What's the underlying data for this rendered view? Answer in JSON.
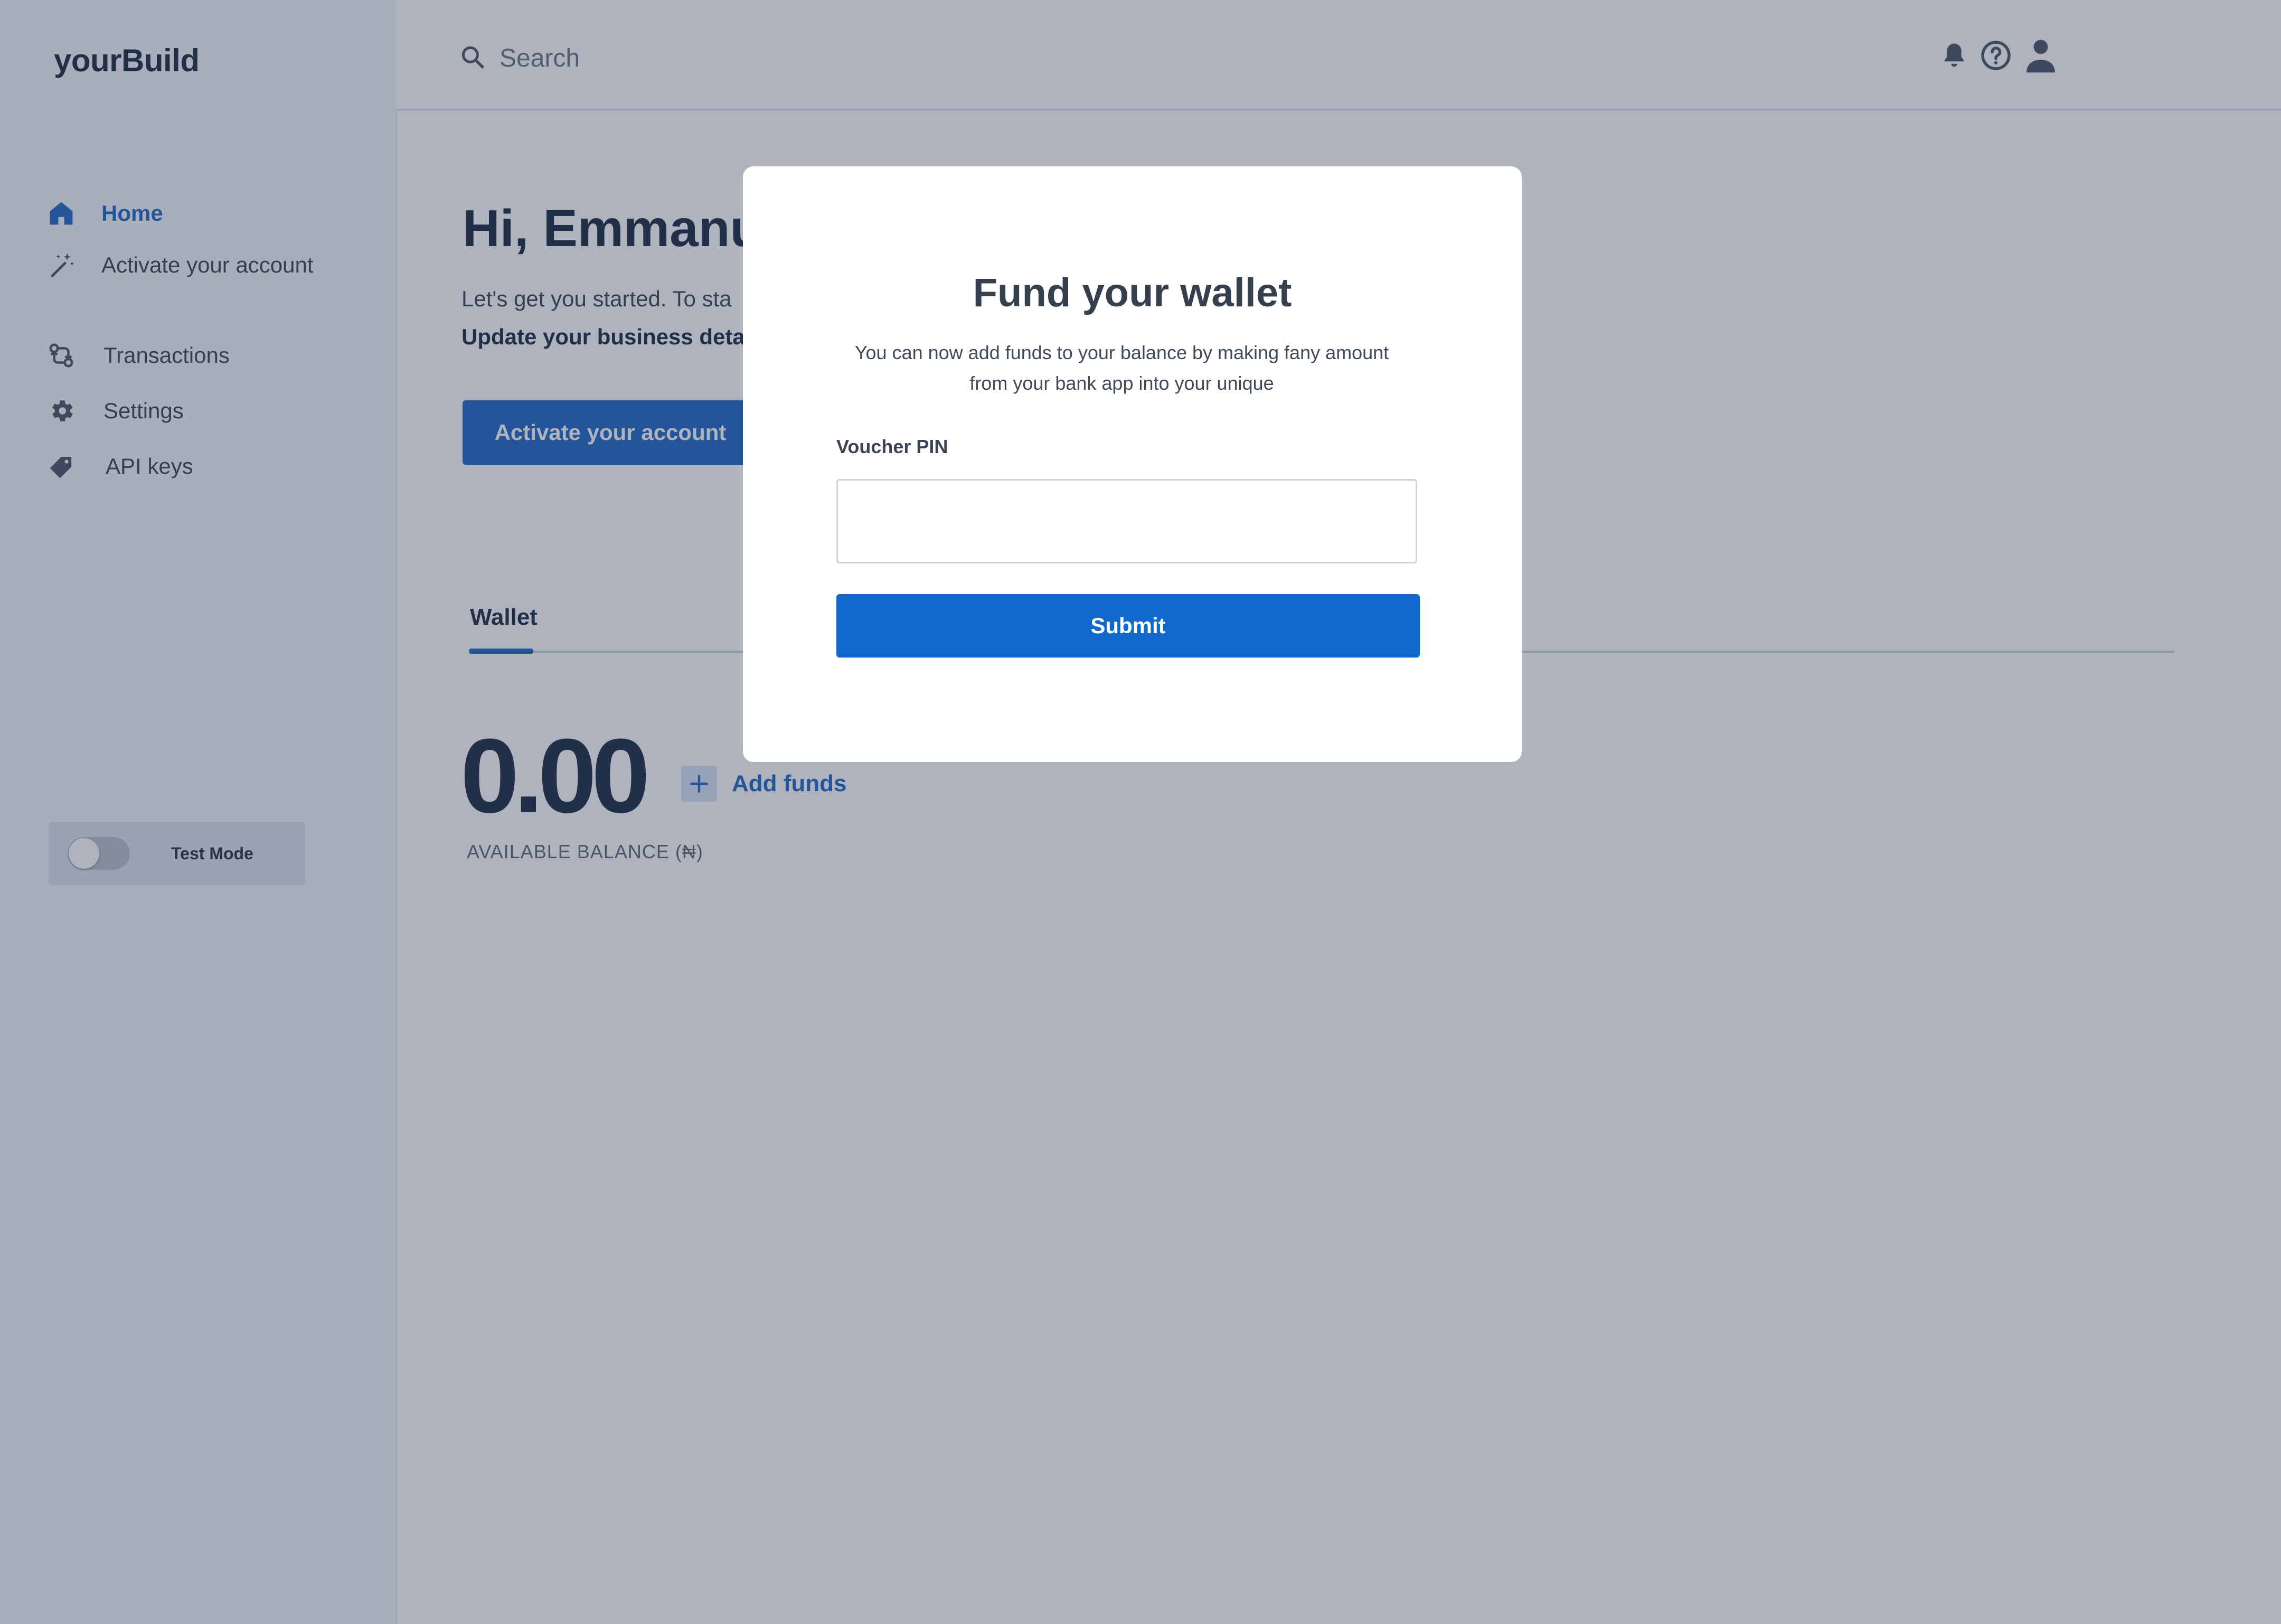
{
  "app": {
    "brand": "yourBuild"
  },
  "sidebar": {
    "items": [
      {
        "label": "Home",
        "icon": "home-icon",
        "active": true
      },
      {
        "label": "Activate your account",
        "icon": "magic-wand-icon"
      },
      {
        "label": "Transactions",
        "icon": "transactions-icon"
      },
      {
        "label": "Settings",
        "icon": "gear-icon"
      },
      {
        "label": "API keys",
        "icon": "tag-icon"
      }
    ],
    "test_mode": {
      "label": "Test Mode",
      "enabled": false
    }
  },
  "header": {
    "search_placeholder": "Search",
    "icons": [
      "bell-icon",
      "help-icon",
      "user-icon"
    ]
  },
  "main": {
    "greeting": "Hi, Emmanu",
    "intro": "Let's get you started. To sta",
    "intro_strong": "Update your business deta",
    "activate_button": "Activate your account",
    "tab": "Wallet",
    "balance": "0.00",
    "add_funds": "Add funds",
    "balance_caption": "AVAILABLE BALANCE (₦)"
  },
  "modal": {
    "title": "Fund your wallet",
    "description_line1": "You can now add funds to your balance by making fany amount",
    "description_line2": "from your bank app into your unique",
    "voucher_label": "Voucher PIN",
    "voucher_value": "",
    "submit_label": "Submit"
  },
  "colors": {
    "accent": "#1f66c5",
    "submit": "#0f6acb",
    "overlay": "rgba(44,55,82,0.38)"
  }
}
